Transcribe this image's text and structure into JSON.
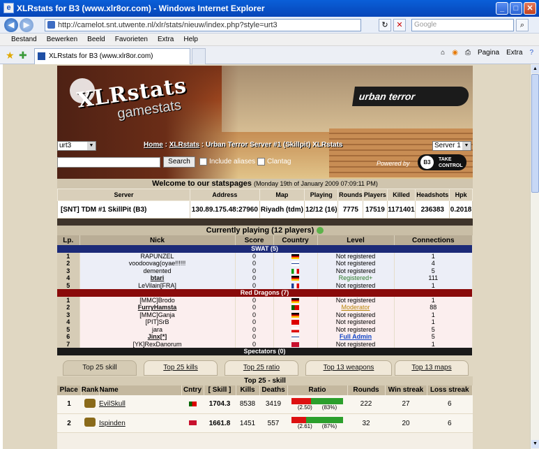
{
  "window": {
    "title": "XLRstats for B3 (www.xlr8or.com) - Windows Internet Explorer"
  },
  "address": {
    "url": "http://camelot.snt.utwente.nl/xlr/stats/nieuw/index.php?style=urt3",
    "search_placeholder": "Google"
  },
  "menu": [
    "Bestand",
    "Bewerken",
    "Beeld",
    "Favorieten",
    "Extra",
    "Help"
  ],
  "tab": {
    "label": "XLRstats for B3 (www.xlr8or.com)"
  },
  "tools": {
    "page": "Pagina",
    "extra": "Extra"
  },
  "banner": {
    "logo": "XLRstats",
    "logo_sub": "gamestats",
    "brand": "urban terror",
    "style_select": "urt3",
    "server_select": "Server 1"
  },
  "breadcrumb": {
    "home": "Home",
    "xlr": "XLRstats",
    "rest": ": Urban Terror Server #1 (Skillpit) XLRstats",
    "sep": ":"
  },
  "search": {
    "button": "Search",
    "include_aliases": "Include aliases",
    "clantag": "Clantag",
    "powered": "Powered by",
    "b3": "TAKE CONTROL"
  },
  "welcome": {
    "text": "Welcome to our statspages",
    "date": "(Monday 19th of January 2009 07:09:11 PM)"
  },
  "server": {
    "headers": [
      "Server",
      "Address",
      "Map",
      "Playing",
      "Rounds",
      "Players",
      "Killed",
      "Headshots",
      "Hpk"
    ],
    "row": {
      "name": "[SNT] TDM #1 SkillPit (B3)",
      "address": "130.89.175.48:27960",
      "map": "Riyadh (tdm)",
      "playing": "12/12 (16)",
      "rounds": "7775",
      "players": "17519",
      "killed": "1171401",
      "headshots": "236383",
      "hpk": "0.2018"
    }
  },
  "current": {
    "title": "Currently playing (12 players)",
    "headers": [
      "Lp.",
      "Nick",
      "Score",
      "Country",
      "Level",
      "Connections"
    ],
    "teams": [
      {
        "name": "SWAT (5)",
        "players": [
          {
            "lp": "1",
            "nick": "RAPUNZEL",
            "score": "0",
            "flag": "de",
            "level": "Not registered",
            "conn": "1"
          },
          {
            "lp": "2",
            "nick": "voodoovag(oyae!!!!!!",
            "score": "0",
            "flag": "gb",
            "level": "Not registered",
            "conn": "4"
          },
          {
            "lp": "3",
            "nick": "demented",
            "score": "0",
            "flag": "it",
            "level": "Not registered",
            "conn": "5"
          },
          {
            "lp": "4",
            "nick": "btari",
            "score": "0",
            "flag": "de",
            "level": "Registered+",
            "conn": "111"
          },
          {
            "lp": "5",
            "nick": "LeVilain[FRA]",
            "score": "0",
            "flag": "fr",
            "level": "Not registered",
            "conn": "1"
          }
        ]
      },
      {
        "name": "Red Dragons (7)",
        "players": [
          {
            "lp": "1",
            "nick": "[MMC]Brodo",
            "score": "0",
            "flag": "de",
            "level": "Not registered",
            "conn": "1"
          },
          {
            "lp": "2",
            "nick": "FurryHamsta",
            "score": "0",
            "flag": "pt",
            "level": "Moderator",
            "conn": "88"
          },
          {
            "lp": "3",
            "nick": "[MMC]Ganja",
            "score": "0",
            "flag": "de",
            "level": "Not registered",
            "conn": "1"
          },
          {
            "lp": "4",
            "nick": "[PIT]SrB",
            "score": "0",
            "flag": "tr",
            "level": "Not registered",
            "conn": "1"
          },
          {
            "lp": "5",
            "nick": "jara",
            "score": "0",
            "flag": "cz",
            "level": "Not registered",
            "conn": "5"
          },
          {
            "lp": "6",
            "nick": "Jinx[*]",
            "score": "0",
            "flag": "gb",
            "level": "Full Admin",
            "conn": "5"
          },
          {
            "lp": "7",
            "nick": "[YK]RexDanorum",
            "score": "0",
            "flag": "dk",
            "level": "Not registered",
            "conn": "1"
          }
        ]
      }
    ],
    "spectators": "Spectators (0)"
  },
  "toptabs": [
    "Top 25 skill",
    "Top 25 kills",
    "Top 25 ratio",
    "Top 13 weapons",
    "Top 13 maps"
  ],
  "top": {
    "title": "Top 25 - skill",
    "headers": [
      "Place",
      "Rank",
      "Name",
      "Cntry",
      "[ Skill ]",
      "Kills",
      "Deaths",
      "Ratio",
      "Rounds",
      "Win streak",
      "Loss streak"
    ],
    "rows": [
      {
        "place": "1",
        "name": "EvilSkull",
        "flag": "pt",
        "skill": "1704.3",
        "kills": "8538",
        "deaths": "3419",
        "ratio": "(2.50)",
        "pct": "(83%)",
        "pctval": 0.83,
        "rounds": "222",
        "win": "27",
        "loss": "6"
      },
      {
        "place": "2",
        "name": "Ispinden",
        "flag": "dk",
        "skill": "1661.8",
        "kills": "1451",
        "deaths": "557",
        "ratio": "(2.61)",
        "pct": "(87%)",
        "pctval": 0.87,
        "rounds": "32",
        "win": "20",
        "loss": "6"
      }
    ]
  },
  "colors": {
    "swat": "#1c2a78",
    "red": "#8a0a0a",
    "accent": "#0a5fd8"
  }
}
